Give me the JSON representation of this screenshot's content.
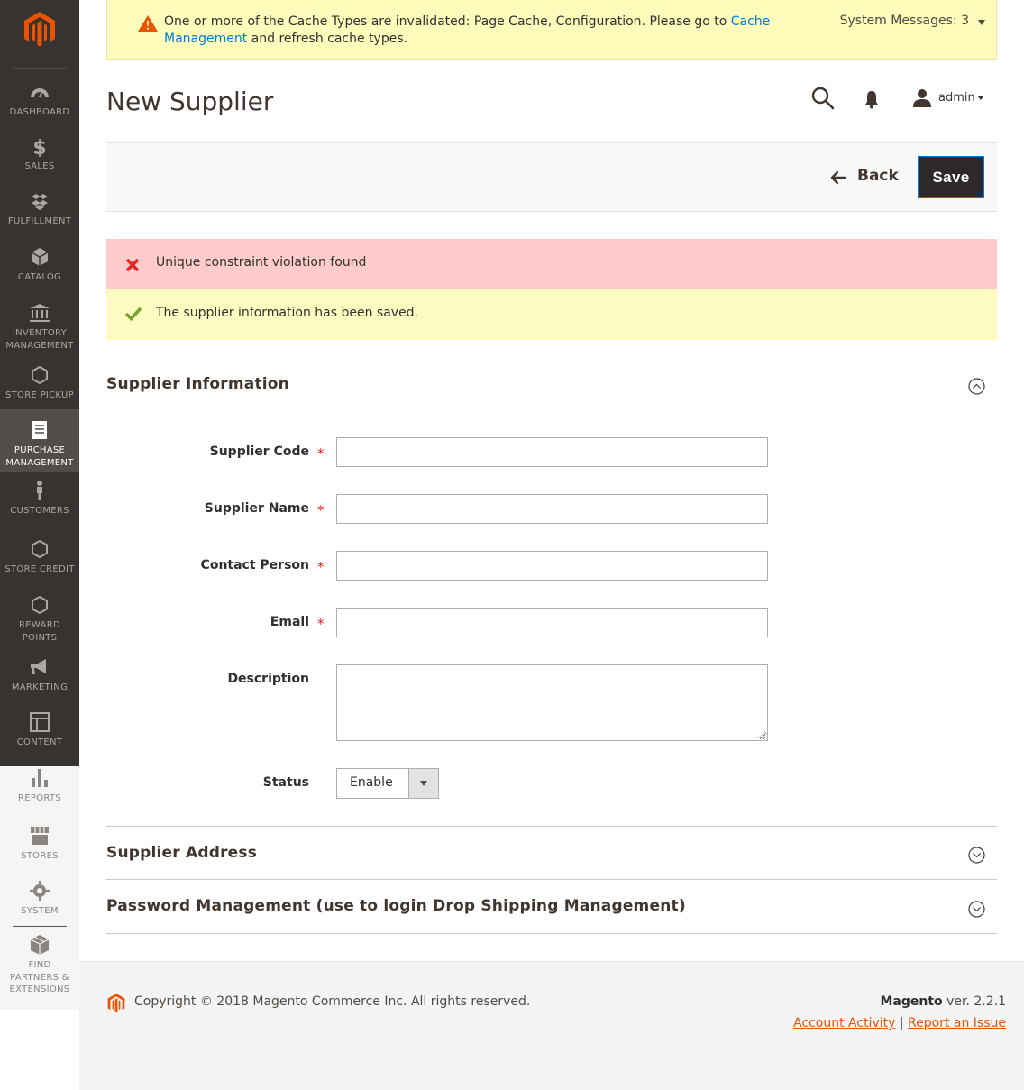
{
  "sidebar": {
    "items": [
      {
        "label": "DASHBOARD",
        "icon": "dashboard-icon"
      },
      {
        "label": "SALES",
        "icon": "dollar-icon"
      },
      {
        "label": "FULFILLMENT",
        "icon": "fulfillment-icon"
      },
      {
        "label": "CATALOG",
        "icon": "cube-icon"
      },
      {
        "label": "INVENTORY MANAGEMENT",
        "icon": "bank-icon"
      },
      {
        "label": "STORE PICKUP",
        "icon": "hexagon-icon"
      },
      {
        "label": "PURCHASE MANAGEMENT",
        "icon": "document-icon"
      },
      {
        "label": "CUSTOMERS",
        "icon": "person-icon"
      },
      {
        "label": "STORE CREDIT",
        "icon": "hexagon-icon"
      },
      {
        "label": "REWARD POINTS",
        "icon": "hexagon-icon"
      },
      {
        "label": "MARKETING",
        "icon": "megaphone-icon"
      },
      {
        "label": "CONTENT",
        "icon": "layout-icon"
      },
      {
        "label": "REPORTS",
        "icon": "bar-chart-icon"
      },
      {
        "label": "STORES",
        "icon": "store-icon"
      },
      {
        "label": "SYSTEM",
        "icon": "gear-icon"
      },
      {
        "label": "FIND PARTNERS & EXTENSIONS",
        "icon": "boxes-icon"
      }
    ],
    "active_item": "PURCHASE MANAGEMENT"
  },
  "system_message": {
    "text_before_link": "One or more of the Cache Types are invalidated: Page Cache, Configuration. Please go to ",
    "link_text": "Cache Management",
    "text_after_link": " and refresh cache types.",
    "count_label": "System Messages: 3"
  },
  "header": {
    "page_title": "New Supplier",
    "user_name": "admin"
  },
  "actions": {
    "back_label": "Back",
    "save_label": "Save"
  },
  "messages": {
    "error": "Unique constraint violation found",
    "success": "The supplier information has been saved."
  },
  "sections": {
    "supplier_information": "Supplier Information",
    "supplier_address": "Supplier Address",
    "password_management": "Password Management (use to login Drop Shipping Management)"
  },
  "form": {
    "supplier_code_label": "Supplier Code",
    "supplier_name_label": "Supplier Name",
    "contact_person_label": "Contact Person",
    "email_label": "Email",
    "description_label": "Description",
    "status_label": "Status",
    "status_value": "Enable",
    "required_mark": "*"
  },
  "footer": {
    "copyright": "Copyright © 2018 Magento Commerce Inc. All rights reserved.",
    "brand": "Magento",
    "version": " ver. 2.2.1",
    "account_activity": "Account Activity",
    "separator": "|",
    "report_issue": "Report an Issue"
  },
  "colors": {
    "sidebar_bg": "#373330",
    "brand_orange": "#eb5202",
    "link_blue": "#007bdb",
    "error_bg": "#ffcccb",
    "success_bg": "#fdfbc0",
    "warning_bg": "#fffbbb",
    "error_icon": "#e22626",
    "success_icon": "#79a22e"
  }
}
